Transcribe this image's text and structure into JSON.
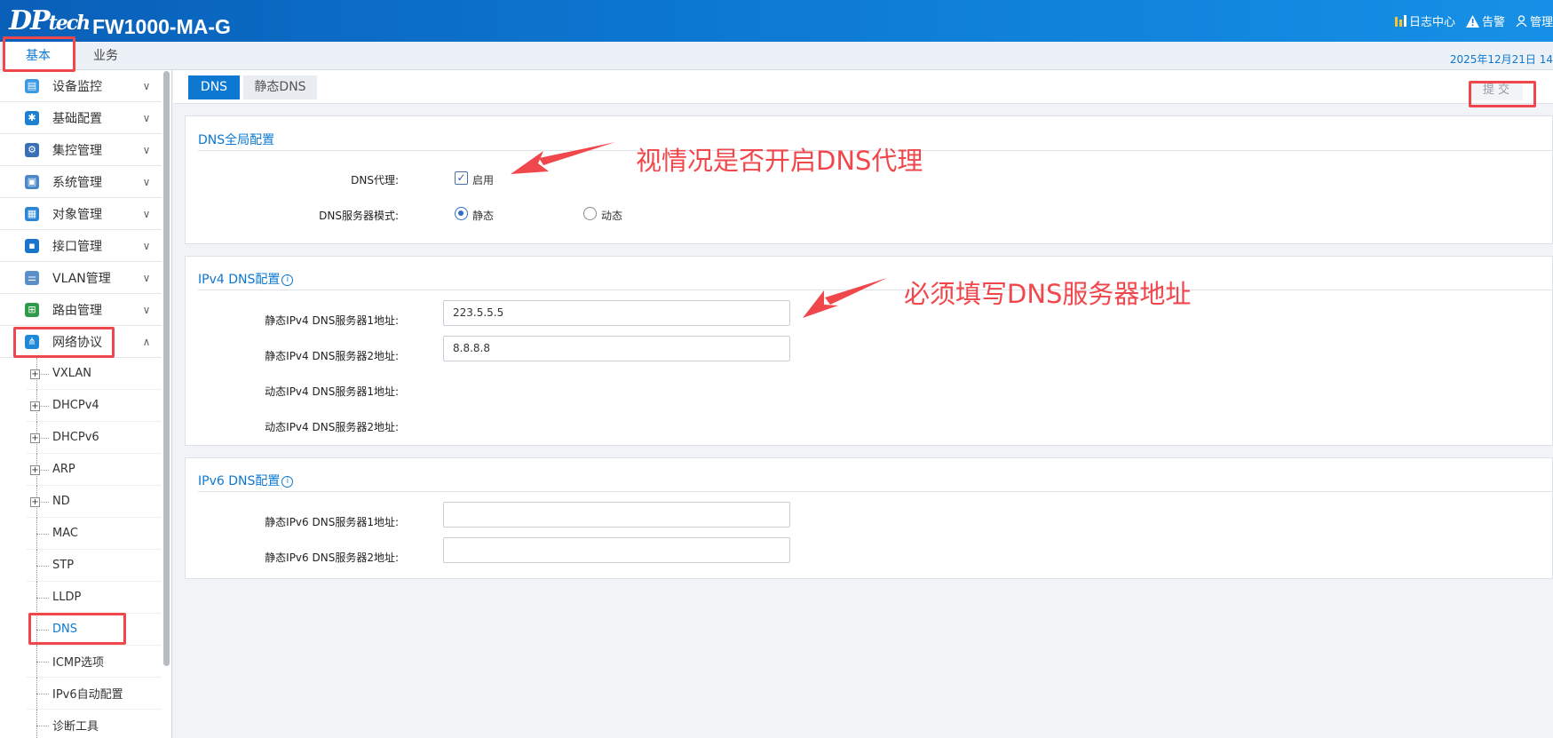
{
  "header": {
    "logo_main": "DP",
    "logo_small": "tech",
    "model": "FW1000-MA-G",
    "log_center": "日志中心",
    "alarm": "告警",
    "admin": "管理"
  },
  "subnav": {
    "tabs": [
      {
        "label": "基本"
      },
      {
        "label": "业务"
      }
    ],
    "datetime": "2025年12月21日  14"
  },
  "sidebar": {
    "items": [
      {
        "label": "设备监控",
        "icon": "monitor-icon"
      },
      {
        "label": "基础配置",
        "icon": "gear-icon"
      },
      {
        "label": "集控管理",
        "icon": "cluster-icon"
      },
      {
        "label": "系统管理",
        "icon": "computer-icon"
      },
      {
        "label": "对象管理",
        "icon": "object-icon"
      },
      {
        "label": "接口管理",
        "icon": "interface-icon"
      },
      {
        "label": "VLAN管理",
        "icon": "vlan-icon"
      },
      {
        "label": "路由管理",
        "icon": "route-icon"
      },
      {
        "label": "网络协议",
        "icon": "network-icon"
      }
    ],
    "sub_items": [
      {
        "label": "VXLAN"
      },
      {
        "label": "DHCPv4"
      },
      {
        "label": "DHCPv6"
      },
      {
        "label": "ARP"
      },
      {
        "label": "ND"
      },
      {
        "label": "MAC"
      },
      {
        "label": "STP"
      },
      {
        "label": "LLDP"
      },
      {
        "label": "DNS"
      },
      {
        "label": "ICMP选项"
      },
      {
        "label": "IPv6自动配置"
      },
      {
        "label": "诊断工具"
      }
    ]
  },
  "main": {
    "tabs": [
      {
        "label": "DNS"
      },
      {
        "label": "静态DNS"
      }
    ],
    "submit_label": "提 交",
    "global": {
      "title": "DNS全局配置",
      "proxy_label": "DNS代理:",
      "proxy_option": "启用",
      "proxy_enabled": true,
      "mode_label": "DNS服务器模式:",
      "mode_static": "静态",
      "mode_dynamic": "动态",
      "mode_selected": "静态"
    },
    "ipv4": {
      "title": "IPv4 DNS配置",
      "info_icon": "i",
      "static1_label": "静态IPv4 DNS服务器1地址:",
      "static1_value": "223.5.5.5",
      "static2_label": "静态IPv4 DNS服务器2地址:",
      "static2_value": "8.8.8.8",
      "dynamic1_label": "动态IPv4 DNS服务器1地址:",
      "dynamic2_label": "动态IPv4 DNS服务器2地址:"
    },
    "ipv6": {
      "title": "IPv6 DNS配置",
      "info_icon": "i",
      "static1_label": "静态IPv6 DNS服务器1地址:",
      "static1_value": "",
      "static2_label": "静态IPv6 DNS服务器2地址:",
      "static2_value": ""
    }
  },
  "annotations": {
    "proxy_note": "视情况是否开启DNS代理",
    "server_note": "必须填写DNS服务器地址"
  },
  "colors": {
    "brand": "#0c78d2",
    "annotation": "#f0474c"
  }
}
